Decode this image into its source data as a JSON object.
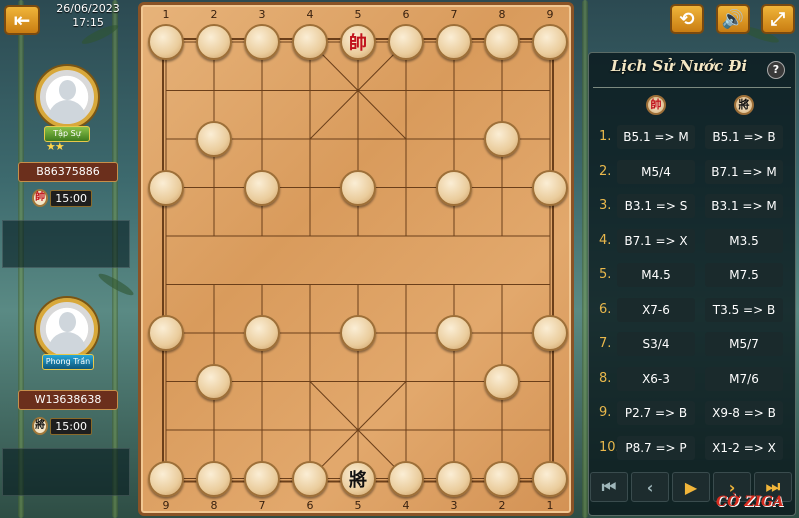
{
  "header": {
    "date": "26/06/2023",
    "time": "17:15"
  },
  "top_player": {
    "rank": "Tập Sự",
    "stars": "★★",
    "name": "B86375886",
    "piece": "帥",
    "time": "15:00"
  },
  "bottom_player": {
    "rank": "Phong Trần",
    "name": "W13638638",
    "piece": "將",
    "time": "15:00"
  },
  "board": {
    "top_files": [
      "1",
      "2",
      "3",
      "4",
      "5",
      "6",
      "7",
      "8",
      "9"
    ],
    "bottom_files": [
      "9",
      "8",
      "7",
      "6",
      "5",
      "4",
      "3",
      "2",
      "1"
    ],
    "red_general": "帥",
    "black_general": "將"
  },
  "history": {
    "title": "Lịch Sử Nước Đi",
    "help": "?",
    "red_icon": "帥",
    "black_icon": "將",
    "moves": [
      {
        "n": "1.",
        "red": "B5.1 => M",
        "black": "B5.1 => B"
      },
      {
        "n": "2.",
        "red": "M5/4",
        "black": "B7.1 => M"
      },
      {
        "n": "3.",
        "red": "B3.1 => S",
        "black": "B3.1 => M"
      },
      {
        "n": "4.",
        "red": "B7.1 => X",
        "black": "M3.5"
      },
      {
        "n": "5.",
        "red": "M4.5",
        "black": "M7.5"
      },
      {
        "n": "6.",
        "red": "X7-6",
        "black": "T3.5 => B"
      },
      {
        "n": "7.",
        "red": "S3/4",
        "black": "M5/7"
      },
      {
        "n": "8.",
        "red": "X6-3",
        "black": "M7/6"
      },
      {
        "n": "9.",
        "red": "P2.7 => B",
        "black": "X9-8 => B"
      },
      {
        "n": "10.",
        "red": "P8.7 => P",
        "black": "X1-2 => X"
      }
    ]
  },
  "icons": {
    "back": "back-icon",
    "rotate": "rotate-icon",
    "sound": "speaker-icon",
    "fullscreen": "fullscreen-icon"
  },
  "watermark": "CỜ ZIGA",
  "colors": {
    "accent": "#e9b84c",
    "red_piece": "#c1121c",
    "board": "#e0a66a"
  }
}
